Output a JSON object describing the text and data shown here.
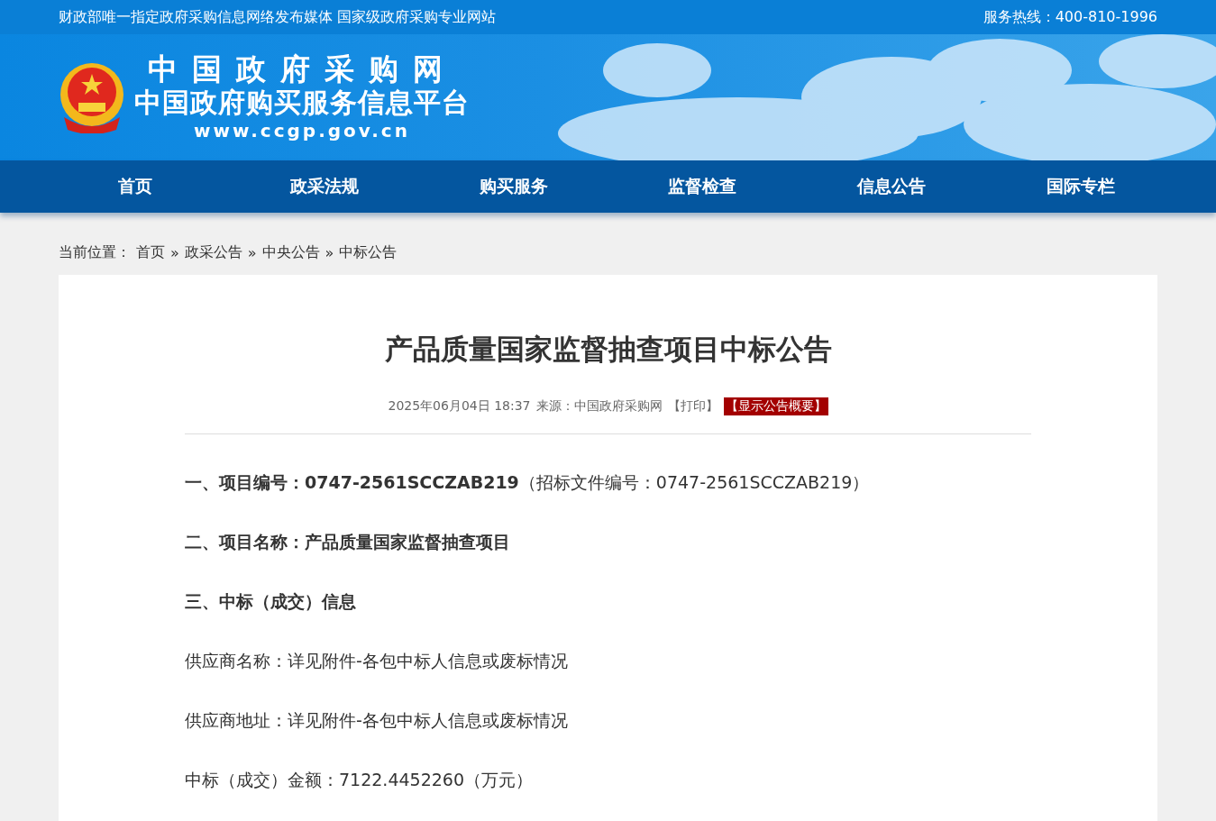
{
  "top_bar": {
    "slogan": "财政部唯一指定政府采购信息网络发布媒体 国家级政府采购专业网站",
    "hotline": "服务热线：400-810-1996"
  },
  "logo": {
    "title": "中国政府采购网",
    "subtitle": "中国政府购买服务信息平台",
    "url": "www.ccgp.gov.cn"
  },
  "nav": [
    "首页",
    "政采法规",
    "购买服务",
    "监督检查",
    "信息公告",
    "国际专栏"
  ],
  "breadcrumb": {
    "label": "当前位置：",
    "items": [
      {
        "text": "首页",
        "sep": "»"
      },
      {
        "text": "政采公告",
        "sep": "»"
      },
      {
        "text": "中央公告",
        "sep": "»"
      },
      {
        "text": "中标公告"
      }
    ]
  },
  "article": {
    "title": "产品质量国家监督抽查项目中标公告",
    "date": "2025年06月04日 18:37",
    "source": "来源：中国政府采购网",
    "print": "【打印】",
    "summary_button": "【显示公告概要】",
    "paragraphs": [
      {
        "kind": "plain",
        "text": "**一、项目编号：0747-2561SCCZAB219**（招标文件编号：0747-2561SCCZAB219）"
      },
      {
        "kind": "heading",
        "text": "二、项目名称：产品质量国家监督抽查项目"
      },
      {
        "kind": "heading",
        "text": "三、中标（成交）信息"
      },
      {
        "kind": "plain",
        "text": "供应商名称：详见附件-各包中标人信息或废标情况"
      },
      {
        "kind": "plain",
        "text": "供应商地址：详见附件-各包中标人信息或废标情况"
      },
      {
        "kind": "plain",
        "text": "中标（成交）金额：7122.4452260（万元）"
      }
    ]
  }
}
